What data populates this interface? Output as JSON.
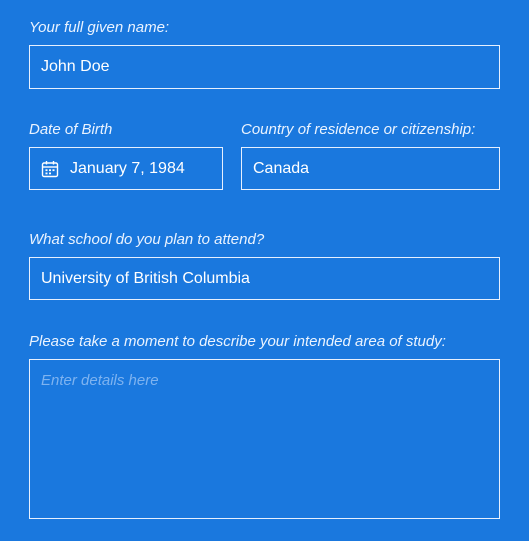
{
  "form": {
    "name": {
      "label": "Your full given name:",
      "value": "John Doe"
    },
    "dob": {
      "label": "Date of Birth",
      "value": "January 7, 1984",
      "icon": "calendar-icon"
    },
    "country": {
      "label": "Country of residence or citizenship:",
      "value": "Canada"
    },
    "school": {
      "label": "What school do you plan to attend?",
      "value": "University of British Columbia"
    },
    "study": {
      "label": "Please take a moment to describe your intended area of study:",
      "placeholder": "Enter details here",
      "value": ""
    }
  },
  "colors": {
    "background": "#1a78de",
    "border": "#e6f0ff",
    "text": "#ffffff",
    "placeholder": "#7eb3f0"
  }
}
